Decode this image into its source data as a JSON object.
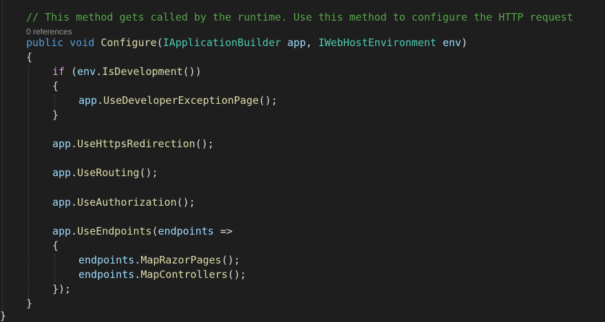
{
  "colors": {
    "background": "#1e1e1e",
    "keyword": "#569cd6",
    "control_keyword": "#d8a0df",
    "comment": "#57a64a",
    "type": "#4ec9b0",
    "method": "#dcdcaa",
    "parameter": "#9cdcfe",
    "plain": "#dcdcdc",
    "codelens": "#999999"
  },
  "editor": {
    "comment": "// This method gets called by the runtime. Use this method to configure the HTTP request",
    "codelens": "0 references",
    "signature": {
      "kw_public": "public",
      "kw_void": "void",
      "method": "Configure",
      "open_paren": "(",
      "type1": "IApplicationBuilder",
      "param1": "app",
      "comma": ", ",
      "type2": "IWebHostEnvironment",
      "param2": "env",
      "close_paren": ")"
    },
    "open_brace": "{",
    "if_line": {
      "kw_if": "if",
      "open": " (",
      "obj": "env",
      "dot": ".",
      "method": "IsDevelopment",
      "close": "())"
    },
    "if_open_brace": "{",
    "dev_page": {
      "obj": "app",
      "method": "UseDeveloperExceptionPage",
      "tail": "();"
    },
    "if_close_brace": "}",
    "https": {
      "obj": "app",
      "method": "UseHttpsRedirection",
      "tail": "();"
    },
    "routing": {
      "obj": "app",
      "method": "UseRouting",
      "tail": "();"
    },
    "authorization": {
      "obj": "app",
      "method": "UseAuthorization",
      "tail": "();"
    },
    "endpoints": {
      "obj": "app",
      "method": "UseEndpoints",
      "open": "(",
      "param": "endpoints",
      "arrow": " =>"
    },
    "lambda_open": "{",
    "razor": {
      "obj": "endpoints",
      "method": "MapRazorPages",
      "tail": "();"
    },
    "controllers": {
      "obj": "endpoints",
      "method": "MapControllers",
      "tail": "();"
    },
    "lambda_close": "});",
    "close_brace": "}",
    "class_close_brace": "}"
  }
}
